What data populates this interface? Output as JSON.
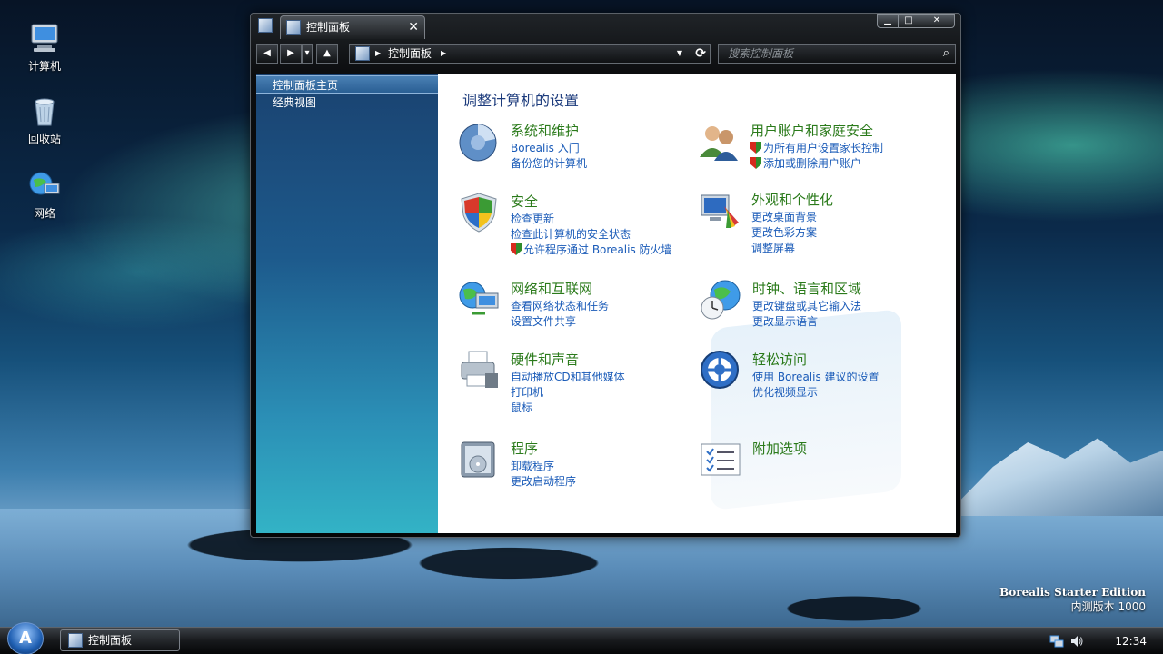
{
  "desktop": {
    "icons": [
      {
        "label": "计算机",
        "icon": "computer-icon"
      },
      {
        "label": "回收站",
        "icon": "recycle-bin-icon"
      },
      {
        "label": "网络",
        "icon": "network-icon"
      }
    ],
    "edition_name": "Borealis Starter Edition",
    "edition_build": "内测版本 1000"
  },
  "window": {
    "tab_title": "控制面板",
    "tab_close": "✕",
    "controls": {
      "minimize": "▁",
      "maximize": "□",
      "close": "✕"
    },
    "nav": {
      "back": "◀",
      "forward": "▶",
      "history": "▾",
      "up": "▲"
    },
    "address": {
      "path": "控制面板",
      "refresh": "⟳"
    },
    "search": {
      "placeholder": "搜索控制面板",
      "icon": "⌕"
    }
  },
  "sidebar": {
    "items": [
      {
        "label": "控制面板主页",
        "active": true
      },
      {
        "label": "经典视图",
        "active": false
      }
    ]
  },
  "main": {
    "title": "调整计算机的设置",
    "categories": [
      {
        "title": "系统和维护",
        "icon": "system-maintenance-icon",
        "links": [
          "Borealis 入门",
          "备份您的计算机"
        ]
      },
      {
        "title": "用户账户和家庭安全",
        "icon": "users-icon",
        "links": [
          "为所有用户设置家长控制",
          "添加或删除用户账户"
        ]
      },
      {
        "title": "安全",
        "icon": "security-shield-icon",
        "links": [
          "检查更新",
          "检查此计算机的安全状态",
          "允许程序通过 Borealis 防火墙"
        ]
      },
      {
        "title": "外观和个性化",
        "icon": "appearance-icon",
        "links": [
          "更改桌面背景",
          "更改色彩方案",
          "调整屏幕"
        ]
      },
      {
        "title": "网络和互联网",
        "icon": "network-internet-icon",
        "links": [
          "查看网络状态和任务",
          "设置文件共享"
        ]
      },
      {
        "title": "时钟、语言和区域",
        "icon": "clock-globe-icon",
        "links": [
          "更改键盘或其它输入法",
          "更改显示语言"
        ]
      },
      {
        "title": "硬件和声音",
        "icon": "printer-icon",
        "links": [
          "自动播放CD和其他媒体",
          "打印机",
          "鼠标"
        ]
      },
      {
        "title": "轻松访问",
        "icon": "ease-of-access-icon",
        "links": [
          "使用 Borealis 建议的设置",
          "优化视频显示"
        ]
      },
      {
        "title": "程序",
        "icon": "programs-icon",
        "links": [
          "卸载程序",
          "更改启动程序"
        ]
      },
      {
        "title": "附加选项",
        "icon": "additional-options-icon",
        "links": []
      }
    ]
  },
  "taskbar": {
    "start_label": "A",
    "task_label": "控制面板",
    "clock": "12:34",
    "tray_icons": [
      "network-tray-icon",
      "volume-tray-icon"
    ]
  },
  "colors": {
    "category_title": "#2a7a1a",
    "link": "#1a5bb8",
    "heading": "#1c3b7c"
  }
}
